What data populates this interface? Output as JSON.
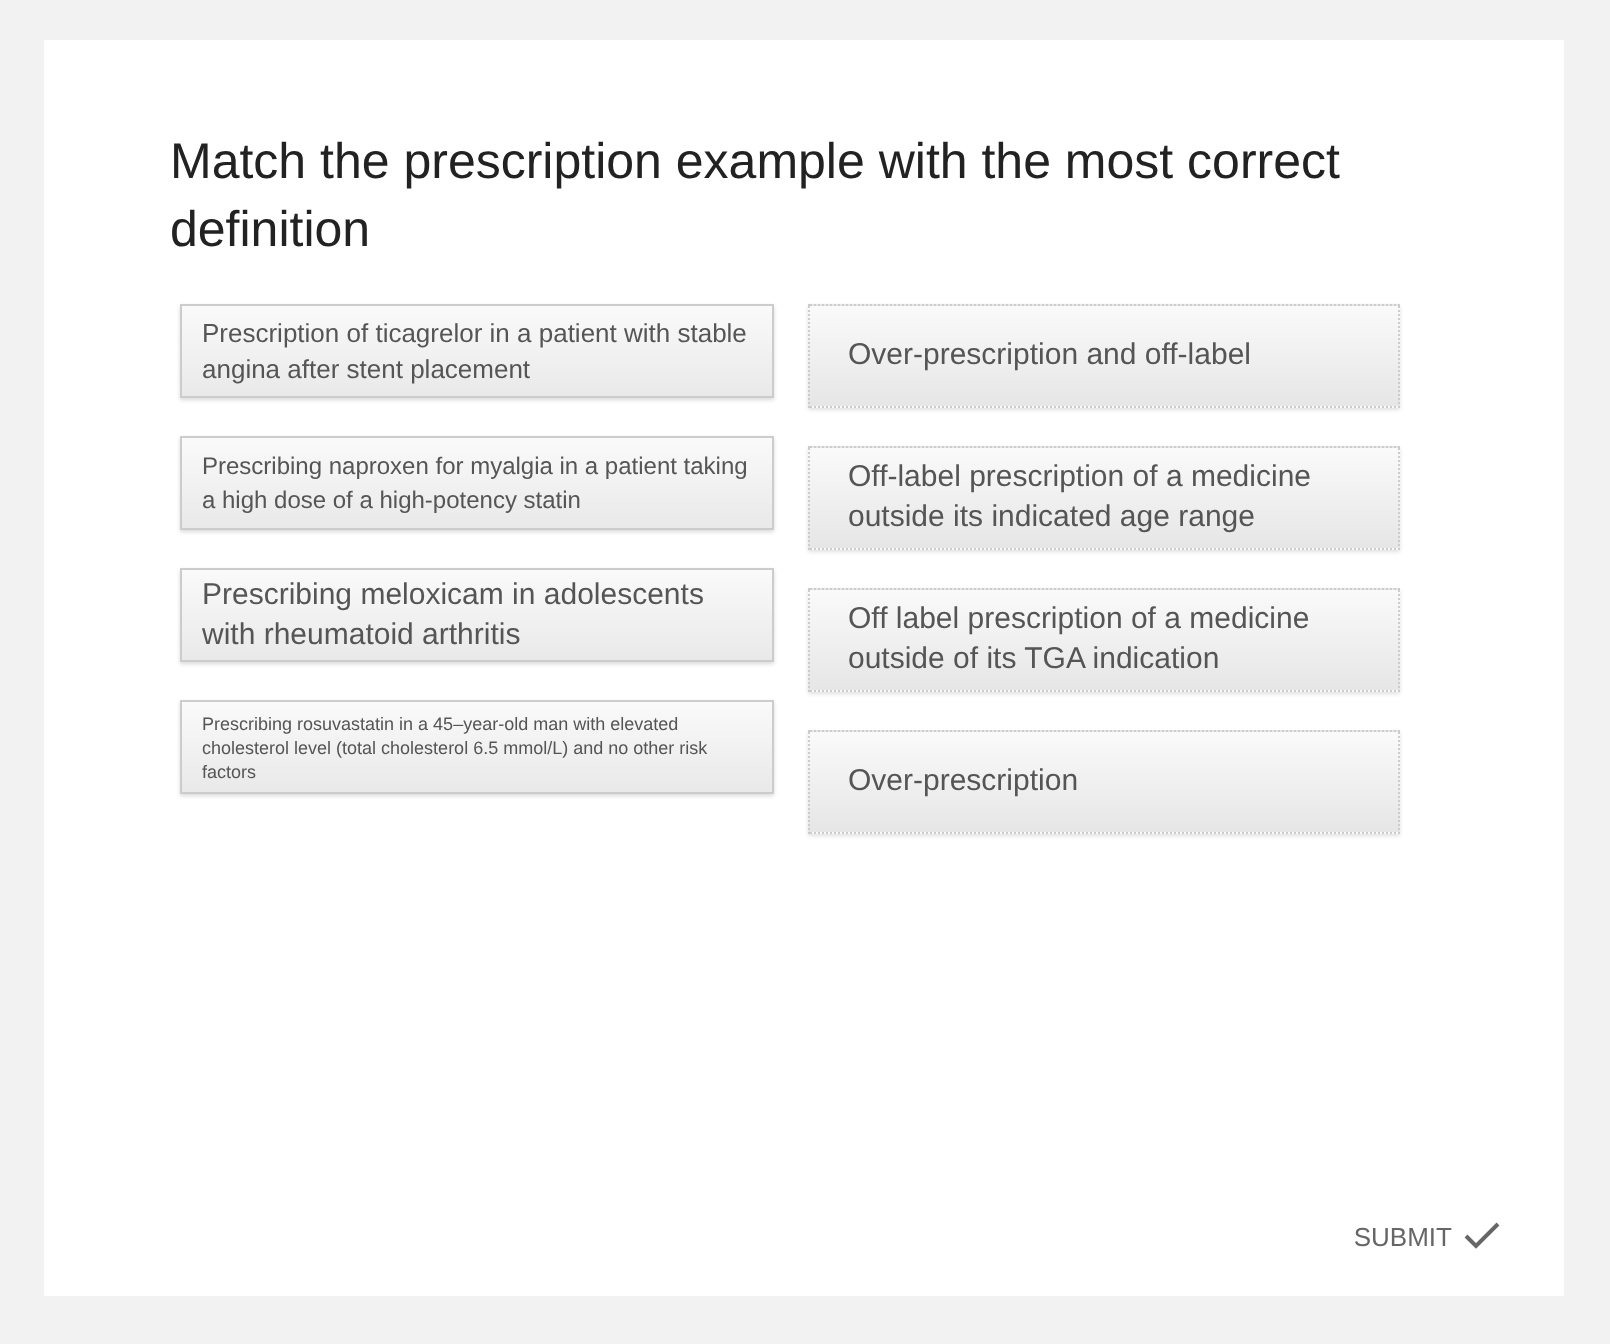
{
  "question": {
    "title": "Match the prescription example with the most correct definition"
  },
  "prompts": [
    {
      "text": "Prescription of ticagrelor in a patient with stable angina after stent placement"
    },
    {
      "text": "Prescribing naproxen for myalgia in a patient taking a high dose of a high-potency statin"
    },
    {
      "text": "Prescribing meloxicam in adolescents with rheumatoid arthritis"
    },
    {
      "text": "Prescribing rosuvastatin in a 45–year-old man with elevated cholesterol level (total cholesterol 6.5 mmol/L) and no other risk factors"
    }
  ],
  "answers": [
    {
      "text": "Over-prescription and off-label"
    },
    {
      "text": "Off-label prescription of a medicine outside its indicated age range"
    },
    {
      "text": "Off label prescription of a medicine outside of its TGA indication"
    },
    {
      "text": "Over-prescription"
    }
  ],
  "submit": {
    "label": "SUBMIT"
  }
}
